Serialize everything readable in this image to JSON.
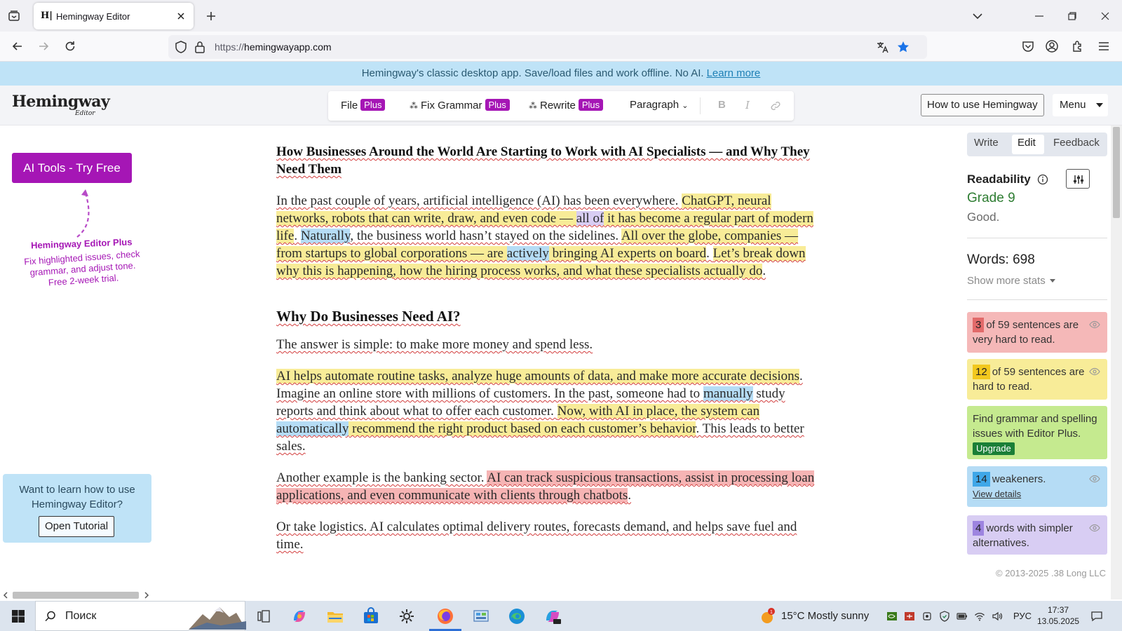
{
  "browser": {
    "tab_title": "Hemingway Editor",
    "tab_favicon": "H|",
    "url_scheme": "https://",
    "url_host": "hemingwayapp.com"
  },
  "banner": {
    "text": "Hemingway's classic desktop app. Save/load files and work offline. No AI.",
    "link": "Learn more"
  },
  "header": {
    "logo": "Hemingway",
    "logo_sub": "Editor",
    "toolbar": {
      "file": "File",
      "fix_grammar": "Fix Grammar",
      "rewrite": "Rewrite",
      "plus_badge": "Plus",
      "paragraph": "Paragraph",
      "bold": "B",
      "italic": "I"
    },
    "how_to": "How to use Hemingway",
    "menu": "Menu"
  },
  "left": {
    "ai_tools": "AI Tools - Try Free",
    "promo_title": "Hemingway Editor Plus",
    "promo_body": "Fix highlighted issues, check grammar, and adjust tone. Free 2-week trial.",
    "tutorial_text": "Want to learn how to use Hemingway Editor?",
    "tutorial_button": "Open Tutorial"
  },
  "editor": {
    "title": "How Businesses Around the World Are Starting to Work with AI Specialists — and Why They Need Them",
    "p1": [
      {
        "t": "In the past couple of years, artificial intelligence (AI) has been everywhere. ",
        "c": ""
      },
      {
        "t": "ChatGPT, neural networks, robots that can write, draw, and even code — ",
        "c": "yel"
      },
      {
        "t": "all of",
        "c": "phr"
      },
      {
        "t": " it has become a regular part of modern life",
        "c": "yel"
      },
      {
        "t": ". ",
        "c": ""
      },
      {
        "t": "Naturally",
        "c": "adv"
      },
      {
        "t": ", the business world hasn’t stayed on the sidelines. ",
        "c": ""
      },
      {
        "t": "All over the globe, companies — from startups to global corporations — are ",
        "c": "yel"
      },
      {
        "t": "actively",
        "c": "adv"
      },
      {
        "t": " bringing AI experts on board",
        "c": "yel"
      },
      {
        "t": ". ",
        "c": ""
      },
      {
        "t": "Let’s break down why this is happening, how the hiring process works, and what these specialists actually do",
        "c": "yel"
      },
      {
        "t": ".",
        "c": ""
      }
    ],
    "h2": "Why Do Businesses Need AI?",
    "p2": "The answer is simple: to make more money and spend less.",
    "p3": [
      {
        "t": "AI helps automate routine tasks, analyze huge amounts of data, and make more accurate decisions",
        "c": "yel"
      },
      {
        "t": ". Imagine an online store with millions of customers. In the past, someone had to ",
        "c": ""
      },
      {
        "t": "manually",
        "c": "adv"
      },
      {
        "t": " study reports and think about what to offer each customer. ",
        "c": ""
      },
      {
        "t": "Now, with AI in place, the system can ",
        "c": "yel"
      },
      {
        "t": "automatically",
        "c": "adv"
      },
      {
        "t": " recommend the right product based on each customer’s behavior",
        "c": "yel"
      },
      {
        "t": ". This leads to better sales.",
        "c": ""
      }
    ],
    "p4": [
      {
        "t": "Another example is the banking sector. ",
        "c": ""
      },
      {
        "t": "AI can track suspicious transactions, assist in processing loan applications, and even communicate with clients through chatbots",
        "c": "red"
      },
      {
        "t": ".",
        "c": ""
      }
    ],
    "p5": "Or take logistics. AI calculates optimal delivery routes, forecasts demand, and helps save fuel and time."
  },
  "right": {
    "tabs": [
      "Write",
      "Edit",
      "Feedback"
    ],
    "readability_label": "Readability",
    "grade": "Grade 9",
    "grade_desc": "Good.",
    "words": "Words: 698",
    "show_more": "Show more stats",
    "cards": {
      "very_hard_num": "3",
      "very_hard_text": "of 59 sentences are very hard to read.",
      "hard_num": "12",
      "hard_text": "of 59 sentences are hard to read.",
      "grammar_text": "Find grammar and spelling issues with Editor Plus.",
      "upgrade": "Upgrade",
      "weakeners_num": "14",
      "weakeners_text": "weakeners.",
      "view_details": "View details",
      "simpler_num": "4",
      "simpler_text": "words with simpler alternatives."
    },
    "copyright": "© 2013-2025 .38 Long LLC"
  },
  "taskbar": {
    "search": "Поиск",
    "weather": "15°C  Mostly sunny",
    "lang": "РУС",
    "time": "17:37",
    "date": "13.05.2025"
  },
  "colors": {
    "plus_purple": "#a516b5",
    "very_hard_bg": "#f5b8b8",
    "hard_bg": "#f8ec98",
    "grammar_bg": "#c5ea8f",
    "weakeners_bg": "#b5dcf5",
    "simpler_bg": "#d8cdf3",
    "grade_green": "#2e7d32"
  }
}
